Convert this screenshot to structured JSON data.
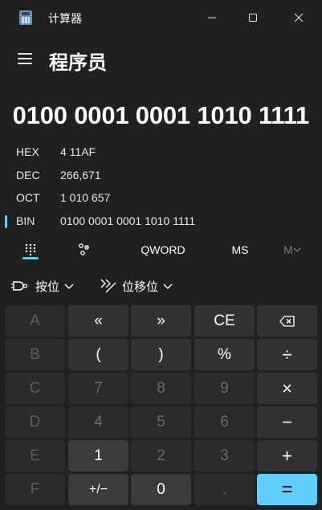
{
  "window": {
    "title": "计算器"
  },
  "header": {
    "mode_title": "程序员"
  },
  "display": {
    "value": "0100 0001 0001 1010 1111"
  },
  "radix": [
    {
      "label": "HEX",
      "value": "4 11AF",
      "selected": false
    },
    {
      "label": "DEC",
      "value": "266,671",
      "selected": false
    },
    {
      "label": "OCT",
      "value": "1 010 657",
      "selected": false
    },
    {
      "label": "BIN",
      "value": "0100 0001 0001 1010 1111",
      "selected": true
    }
  ],
  "toolbar": {
    "word_size": "QWORD",
    "memory_store": "MS",
    "memory_list": "M"
  },
  "dropdowns": {
    "bitwise": "按位",
    "bit_shift": "位移位"
  },
  "keys": {
    "A": "A",
    "B": "B",
    "C": "C",
    "D": "D",
    "E": "E",
    "F": "F",
    "lshift": "«",
    "rshift": "»",
    "clear_entry": "CE",
    "lparen": "(",
    "rparen": ")",
    "percent": "%",
    "divide": "÷",
    "multiply": "×",
    "minus": "−",
    "plus": "+",
    "seven": "7",
    "eight": "8",
    "nine": "9",
    "four": "4",
    "five": "5",
    "six": "6",
    "one": "1",
    "two": "2",
    "three": "3",
    "negate": "+/−",
    "zero": "0",
    "decimal": ".",
    "equals": "="
  },
  "colors": {
    "accent": "#60cdff",
    "background": "#202020"
  }
}
